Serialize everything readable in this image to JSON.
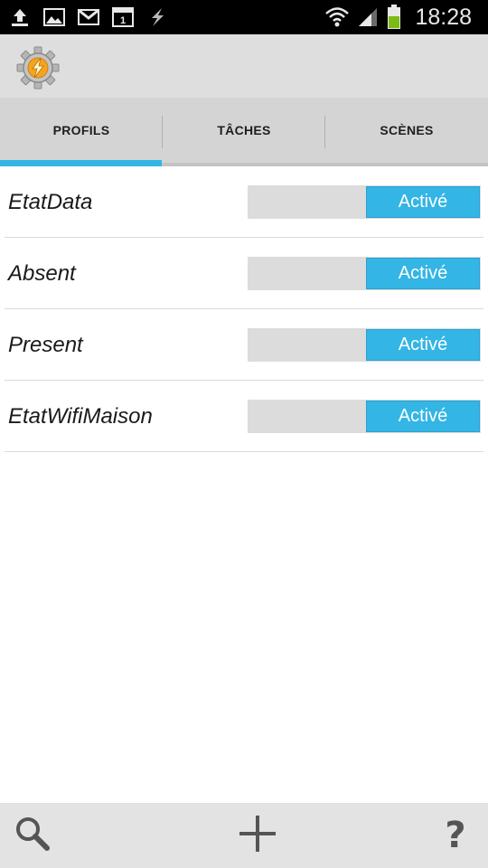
{
  "status_bar": {
    "time": "18:28",
    "icons": [
      "upload-icon",
      "image-icon",
      "gmail-icon",
      "calendar-icon",
      "tasker-bolt-icon",
      "wifi-icon",
      "signal-icon",
      "battery-icon"
    ],
    "calendar_day": "1"
  },
  "app": {
    "logo": "tasker-gear-logo",
    "accent_color": "#33b5e5"
  },
  "tabs": [
    {
      "label": "PROFILS",
      "selected": true
    },
    {
      "label": "TÂCHES",
      "selected": false
    },
    {
      "label": "SCÈNES",
      "selected": false
    }
  ],
  "profiles": [
    {
      "name": "EtatData",
      "toggle_label": "Activé"
    },
    {
      "name": "Absent",
      "toggle_label": "Activé"
    },
    {
      "name": "Present",
      "toggle_label": "Activé"
    },
    {
      "name": "EtatWifiMaison",
      "toggle_label": "Activé"
    }
  ],
  "bottom_bar": {
    "buttons": [
      "search-icon",
      "add-icon",
      "help-icon"
    ],
    "help_glyph": "?"
  }
}
